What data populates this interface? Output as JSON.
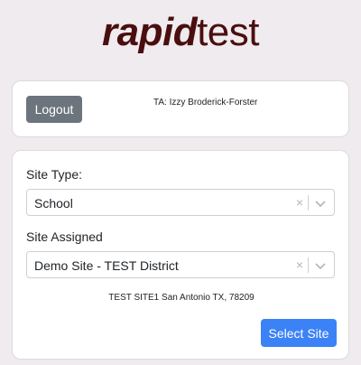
{
  "logo": {
    "bold_part": "rapid",
    "light_part": "test"
  },
  "header_card": {
    "logout_label": "Logout",
    "ta_text": "TA: Izzy Broderick-Forster"
  },
  "form": {
    "site_type_label": "Site Type:",
    "site_type_value": "School",
    "site_assigned_label": "Site Assigned",
    "site_assigned_value": "Demo Site - TEST District",
    "address": "TEST SITE1 San Antonio TX, 78209",
    "select_site_label": "Select Site"
  },
  "icons": {
    "clear": "×",
    "chevron": "chevron-down-icon"
  },
  "colors": {
    "logo": "#4a0e0e",
    "logout_button": "#6c757d",
    "primary_button": "#3b82f6",
    "background": "#efebee"
  }
}
